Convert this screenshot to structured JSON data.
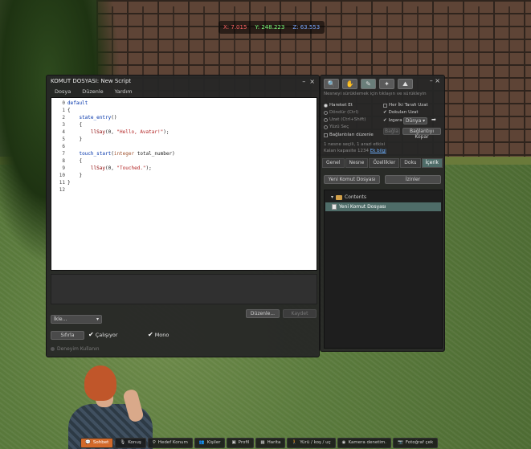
{
  "coords": {
    "x": "X: 7.015",
    "y": "Y: 248.223",
    "z": "Z: 63.553"
  },
  "script_window": {
    "title": "KOMUT DOSYASI: New Script",
    "menu": [
      "Dosya",
      "Düzenle",
      "Yardım"
    ],
    "code_lines": [
      {
        "n": "0",
        "segments": [
          {
            "t": "default",
            "c": "kw"
          }
        ]
      },
      {
        "n": "1",
        "segments": [
          {
            "t": "{",
            "c": ""
          }
        ]
      },
      {
        "n": "2",
        "segments": [
          {
            "t": "    ",
            "c": ""
          },
          {
            "t": "state_entry",
            "c": "ev"
          },
          {
            "t": "()",
            "c": ""
          }
        ]
      },
      {
        "n": "3",
        "segments": [
          {
            "t": "    {",
            "c": ""
          }
        ]
      },
      {
        "n": "4",
        "segments": [
          {
            "t": "        ",
            "c": ""
          },
          {
            "t": "llSay",
            "c": "fn"
          },
          {
            "t": "(0, ",
            "c": ""
          },
          {
            "t": "\"Hello, Avatar!\"",
            "c": "str"
          },
          {
            "t": ");",
            "c": ""
          }
        ]
      },
      {
        "n": "5",
        "segments": [
          {
            "t": "    }",
            "c": ""
          }
        ]
      },
      {
        "n": "6",
        "segments": [
          {
            "t": "",
            "c": ""
          }
        ]
      },
      {
        "n": "7",
        "segments": [
          {
            "t": "    ",
            "c": ""
          },
          {
            "t": "touch_start",
            "c": "ev"
          },
          {
            "t": "(",
            "c": ""
          },
          {
            "t": "integer",
            "c": "ty"
          },
          {
            "t": " total_number)",
            "c": ""
          }
        ]
      },
      {
        "n": "8",
        "segments": [
          {
            "t": "    {",
            "c": ""
          }
        ]
      },
      {
        "n": "9",
        "segments": [
          {
            "t": "        ",
            "c": ""
          },
          {
            "t": "llSay",
            "c": "fn"
          },
          {
            "t": "(0, ",
            "c": ""
          },
          {
            "t": "\"Touched.\"",
            "c": "str"
          },
          {
            "t": ");",
            "c": ""
          }
        ]
      },
      {
        "n": "10",
        "segments": [
          {
            "t": "    }",
            "c": ""
          }
        ]
      },
      {
        "n": "11",
        "segments": [
          {
            "t": "}",
            "c": ""
          }
        ]
      },
      {
        "n": "12",
        "segments": [
          {
            "t": "",
            "c": ""
          }
        ]
      }
    ],
    "edit_button": "Düzenle...",
    "save_button": "Kaydet",
    "insert_select": "İkle...",
    "reset_button": "Sıfırla",
    "running_label": "Çalışıyor",
    "mono_label": "Mono",
    "experience_label": "Deneyim Kullanın"
  },
  "build_window": {
    "tools": [
      "focus",
      "move",
      "edit",
      "create",
      "land"
    ],
    "help_text": "Nesneyi sürüklemek için tıklayın ve sürükleyin",
    "options_left": [
      "Hareket Et",
      "Döndür (Ctrl)",
      "Uzat (Ctrl+Shift)",
      "Yüzü Seç"
    ],
    "options_right": [
      "Her İki Tarafı Uzat",
      "Dokuları Uzat",
      "Izgara"
    ],
    "grid_select": "Dünya",
    "linked_edit": "Bağlantıları düzenle",
    "link_button": "Bağla",
    "unlink_button": "Bağlantıyı Kopar",
    "info_line1": "1 nesne seçili, 1 arazi etkisi",
    "info_line2": "Kalan kapasite 1234",
    "info_link": "Ek bilgi",
    "tabs": [
      "Genel",
      "Nesne",
      "Özellikler",
      "Doku",
      "İçerik"
    ],
    "new_script_button": "Yeni Komut Dosyası",
    "permissions_button": "İzinler",
    "contents_folder": "Contents",
    "contents_item": "Yeni Komut Dosyası"
  },
  "bottombar": [
    {
      "label": "Sohbet",
      "icon": "chat-icon"
    },
    {
      "label": "Konuş",
      "icon": "speak-icon"
    },
    {
      "label": "Hedef Konum",
      "icon": "destination-icon"
    },
    {
      "label": "Kişiler",
      "icon": "people-icon"
    },
    {
      "label": "Profil",
      "icon": "profile-icon"
    },
    {
      "label": "Harita",
      "icon": "map-icon"
    },
    {
      "label": "Yürü / koş / uç",
      "icon": "walk-icon"
    },
    {
      "label": "Kamera denetim.",
      "icon": "camera-icon"
    },
    {
      "label": "Fotoğraf çek",
      "icon": "snapshot-icon"
    }
  ]
}
